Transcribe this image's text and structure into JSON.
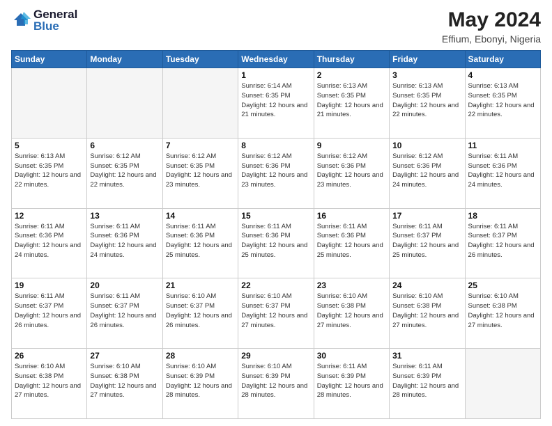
{
  "header": {
    "logo_general": "General",
    "logo_blue": "Blue",
    "month_year": "May 2024",
    "location": "Effium, Ebonyi, Nigeria"
  },
  "days_of_week": [
    "Sunday",
    "Monday",
    "Tuesday",
    "Wednesday",
    "Thursday",
    "Friday",
    "Saturday"
  ],
  "weeks": [
    [
      {
        "day": "",
        "info": ""
      },
      {
        "day": "",
        "info": ""
      },
      {
        "day": "",
        "info": ""
      },
      {
        "day": "1",
        "info": "Sunrise: 6:14 AM\nSunset: 6:35 PM\nDaylight: 12 hours and 21 minutes."
      },
      {
        "day": "2",
        "info": "Sunrise: 6:13 AM\nSunset: 6:35 PM\nDaylight: 12 hours and 21 minutes."
      },
      {
        "day": "3",
        "info": "Sunrise: 6:13 AM\nSunset: 6:35 PM\nDaylight: 12 hours and 22 minutes."
      },
      {
        "day": "4",
        "info": "Sunrise: 6:13 AM\nSunset: 6:35 PM\nDaylight: 12 hours and 22 minutes."
      }
    ],
    [
      {
        "day": "5",
        "info": "Sunrise: 6:13 AM\nSunset: 6:35 PM\nDaylight: 12 hours and 22 minutes."
      },
      {
        "day": "6",
        "info": "Sunrise: 6:12 AM\nSunset: 6:35 PM\nDaylight: 12 hours and 22 minutes."
      },
      {
        "day": "7",
        "info": "Sunrise: 6:12 AM\nSunset: 6:35 PM\nDaylight: 12 hours and 23 minutes."
      },
      {
        "day": "8",
        "info": "Sunrise: 6:12 AM\nSunset: 6:36 PM\nDaylight: 12 hours and 23 minutes."
      },
      {
        "day": "9",
        "info": "Sunrise: 6:12 AM\nSunset: 6:36 PM\nDaylight: 12 hours and 23 minutes."
      },
      {
        "day": "10",
        "info": "Sunrise: 6:12 AM\nSunset: 6:36 PM\nDaylight: 12 hours and 24 minutes."
      },
      {
        "day": "11",
        "info": "Sunrise: 6:11 AM\nSunset: 6:36 PM\nDaylight: 12 hours and 24 minutes."
      }
    ],
    [
      {
        "day": "12",
        "info": "Sunrise: 6:11 AM\nSunset: 6:36 PM\nDaylight: 12 hours and 24 minutes."
      },
      {
        "day": "13",
        "info": "Sunrise: 6:11 AM\nSunset: 6:36 PM\nDaylight: 12 hours and 24 minutes."
      },
      {
        "day": "14",
        "info": "Sunrise: 6:11 AM\nSunset: 6:36 PM\nDaylight: 12 hours and 25 minutes."
      },
      {
        "day": "15",
        "info": "Sunrise: 6:11 AM\nSunset: 6:36 PM\nDaylight: 12 hours and 25 minutes."
      },
      {
        "day": "16",
        "info": "Sunrise: 6:11 AM\nSunset: 6:36 PM\nDaylight: 12 hours and 25 minutes."
      },
      {
        "day": "17",
        "info": "Sunrise: 6:11 AM\nSunset: 6:37 PM\nDaylight: 12 hours and 25 minutes."
      },
      {
        "day": "18",
        "info": "Sunrise: 6:11 AM\nSunset: 6:37 PM\nDaylight: 12 hours and 26 minutes."
      }
    ],
    [
      {
        "day": "19",
        "info": "Sunrise: 6:11 AM\nSunset: 6:37 PM\nDaylight: 12 hours and 26 minutes."
      },
      {
        "day": "20",
        "info": "Sunrise: 6:11 AM\nSunset: 6:37 PM\nDaylight: 12 hours and 26 minutes."
      },
      {
        "day": "21",
        "info": "Sunrise: 6:10 AM\nSunset: 6:37 PM\nDaylight: 12 hours and 26 minutes."
      },
      {
        "day": "22",
        "info": "Sunrise: 6:10 AM\nSunset: 6:37 PM\nDaylight: 12 hours and 27 minutes."
      },
      {
        "day": "23",
        "info": "Sunrise: 6:10 AM\nSunset: 6:38 PM\nDaylight: 12 hours and 27 minutes."
      },
      {
        "day": "24",
        "info": "Sunrise: 6:10 AM\nSunset: 6:38 PM\nDaylight: 12 hours and 27 minutes."
      },
      {
        "day": "25",
        "info": "Sunrise: 6:10 AM\nSunset: 6:38 PM\nDaylight: 12 hours and 27 minutes."
      }
    ],
    [
      {
        "day": "26",
        "info": "Sunrise: 6:10 AM\nSunset: 6:38 PM\nDaylight: 12 hours and 27 minutes."
      },
      {
        "day": "27",
        "info": "Sunrise: 6:10 AM\nSunset: 6:38 PM\nDaylight: 12 hours and 27 minutes."
      },
      {
        "day": "28",
        "info": "Sunrise: 6:10 AM\nSunset: 6:39 PM\nDaylight: 12 hours and 28 minutes."
      },
      {
        "day": "29",
        "info": "Sunrise: 6:10 AM\nSunset: 6:39 PM\nDaylight: 12 hours and 28 minutes."
      },
      {
        "day": "30",
        "info": "Sunrise: 6:11 AM\nSunset: 6:39 PM\nDaylight: 12 hours and 28 minutes."
      },
      {
        "day": "31",
        "info": "Sunrise: 6:11 AM\nSunset: 6:39 PM\nDaylight: 12 hours and 28 minutes."
      },
      {
        "day": "",
        "info": ""
      }
    ]
  ]
}
